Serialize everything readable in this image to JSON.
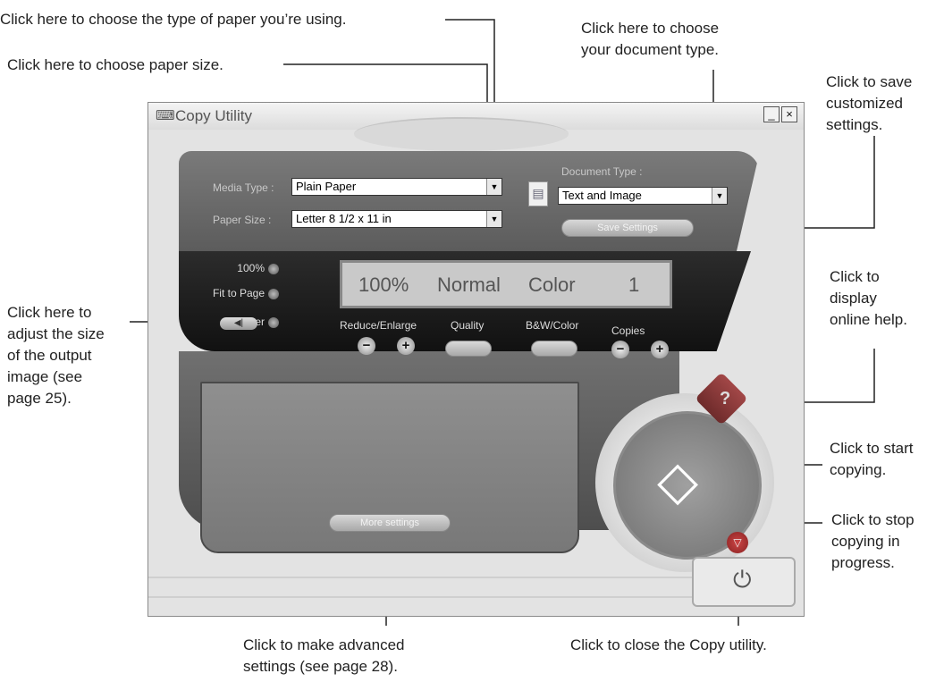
{
  "callouts": {
    "paper_type": "Click here to choose the type of paper you’re using.",
    "paper_size": "Click here to choose paper size.",
    "document_type": "Click here to choose\nyour document type.",
    "save_settings": "Click to save\ncustomized\nsettings.",
    "online_help": "Click to\ndisplay\nonline help.",
    "output_size": "Click here to\nadjust the size\nof the output\nimage (see\npage 25).",
    "start": "Click to start\ncopying.",
    "stop": "Click to stop\ncopying in\nprogress.",
    "advanced": "Click to make advanced\nsettings (see page 28).",
    "close": "Click to close the Copy utility."
  },
  "window": {
    "title": "Copy Utility",
    "minimize": "_",
    "close": "×"
  },
  "media_type": {
    "label": "Media Type :",
    "value": "Plain Paper"
  },
  "paper_size": {
    "label": "Paper Size :",
    "value": "Letter 8 1/2 x 11 in"
  },
  "document_type": {
    "label": "Document Type :",
    "value": "Text and Image"
  },
  "save_settings_label": "Save Settings",
  "scale_options": [
    "100%",
    "Fit to Page",
    "Other"
  ],
  "display": {
    "scale": "100%",
    "quality": "Normal",
    "color": "Color",
    "copies": "1"
  },
  "controls": {
    "reduce_enlarge": "Reduce/Enlarge",
    "quality": "Quality",
    "bw_color": "B&W/Color",
    "copies": "Copies"
  },
  "more_settings_label": "More settings",
  "icons": {
    "minus": "−",
    "plus": "+",
    "arrow_left": "◀|",
    "start": "◇",
    "help": "?",
    "stop": "▽",
    "power": "⏻",
    "dropdown": "▼"
  }
}
